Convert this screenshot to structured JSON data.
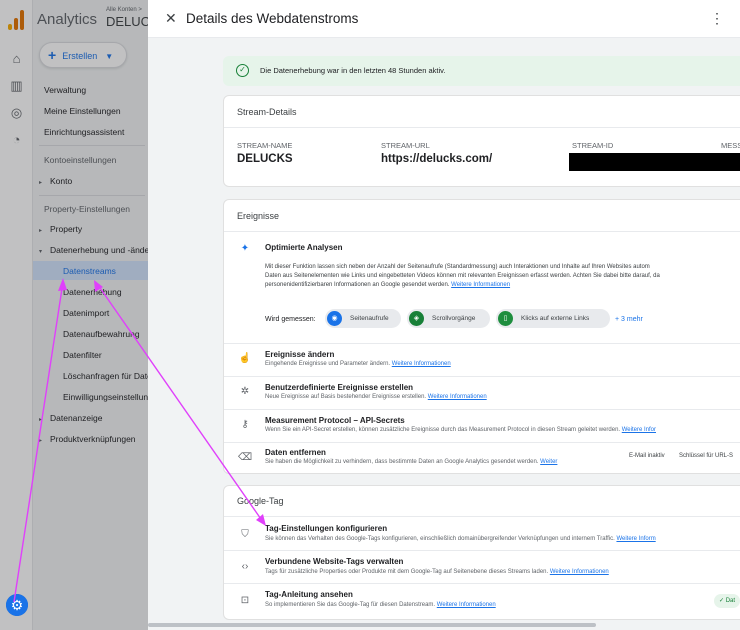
{
  "app": {
    "product_name": "Analytics",
    "account_crumb": "Alle Konten >",
    "account_name": "DELUCKS"
  },
  "sidebar": {
    "create_label": "Erstellen",
    "items": [
      {
        "label": "Verwaltung"
      },
      {
        "label": "Meine Einstellungen"
      },
      {
        "label": "Einrichtungsassistent"
      },
      {
        "label": "Kontoeinstellungen"
      },
      {
        "label": "Konto"
      },
      {
        "label": "Property-Einstellungen"
      },
      {
        "label": "Property"
      },
      {
        "label": "Datenerhebung und -änderung"
      },
      {
        "label": "Datenstreams"
      },
      {
        "label": "Datenerhebung"
      },
      {
        "label": "Datenimport"
      },
      {
        "label": "Datenaufbewahrung"
      },
      {
        "label": "Datenfilter"
      },
      {
        "label": "Löschanfragen für Daten"
      },
      {
        "label": "Einwilligungseinstellungen"
      },
      {
        "label": "Datenanzeige"
      },
      {
        "label": "Produktverknüpfungen"
      }
    ],
    "active_item": "Datenstreams"
  },
  "panel": {
    "title": "Details des Webdatenstroms",
    "status_text": "Die Datenerhebung war in den letzten 48 Stunden aktiv.",
    "stream_details": {
      "heading": "Stream-Details",
      "columns": [
        {
          "label": "STREAM-NAME",
          "value": "DELUCKS"
        },
        {
          "label": "STREAM-URL",
          "value": "https://delucks.com/"
        },
        {
          "label": "STREAM-ID",
          "value": ""
        },
        {
          "label": "MESS",
          "value": ""
        }
      ]
    },
    "events": {
      "heading": "Ereignisse",
      "optimized": {
        "title": "Optimierte Analysen",
        "text_1": "Mit dieser Funktion lassen sich neben der Anzahl der Seitenaufrufe (Standardmessung) auch Interaktionen und Inhalte auf Ihren Websites autom",
        "text_2": "Daten aus Seitenelementen wie Links und eingebetteten Videos können mit relevanten Ereignissen erfasst werden. Achten Sie dabei bitte darauf, da",
        "text_3": "personenidentifizierbaren Informationen an Google gesendet werden.",
        "link": "Weitere Informationen",
        "measured_label": "Wird gemessen:",
        "chips": [
          "Seitenaufrufe",
          "Scrollvorgänge",
          "Klicks auf externe Links"
        ],
        "more": "+ 3 mehr"
      },
      "rows": [
        {
          "title": "Ereignisse ändern",
          "desc": "Eingehende Ereignisse und Parameter ändern.",
          "link": "Weitere Informationen"
        },
        {
          "title": "Benutzerdefinierte Ereignisse erstellen",
          "desc": "Neue Ereignisse auf Basis bestehender Ereignisse erstellen.",
          "link": "Weitere Informationen"
        },
        {
          "title": "Measurement Protocol – API-Secrets",
          "desc": "Wenn Sie ein API-Secret erstellen, können zusätzliche Ereignisse durch das Measurement Protocol in diesen Stream geleitet werden.",
          "link": "Weitere Infor"
        },
        {
          "title": "Daten entfernen",
          "desc": "Sie haben die Möglichkeit zu verhindern, dass bestimmte Daten an Google Analytics gesendet werden.",
          "link": "Weiter",
          "status_1": "E-Mail inaktiv",
          "status_2": "Schlüssel für URL-S"
        }
      ]
    },
    "google_tag": {
      "heading": "Google-Tag",
      "rows": [
        {
          "title": "Tag-Einstellungen konfigurieren",
          "desc": "Sie können das Verhalten des Google-Tags konfigurieren, einschließlich domainübergreifender Verknüpfungen und internem Traffic.",
          "link": "Weitere Inform"
        },
        {
          "title": "Verbundene Website-Tags verwalten",
          "desc": "Tags für zusätzliche Properties oder Produkte mit dem Google-Tag auf Seitenebene dieses Streams laden.",
          "link": "Weitere Informationen"
        },
        {
          "title": "Tag-Anleitung ansehen",
          "desc": "So implementieren Sie das Google-Tag für diesen Datenstream.",
          "link": "Weitere Informationen",
          "badge": "✓ Dat"
        }
      ]
    }
  },
  "colors": {
    "accent": "#1a73e8",
    "success": "#188038",
    "annotation": "#e040fb"
  }
}
